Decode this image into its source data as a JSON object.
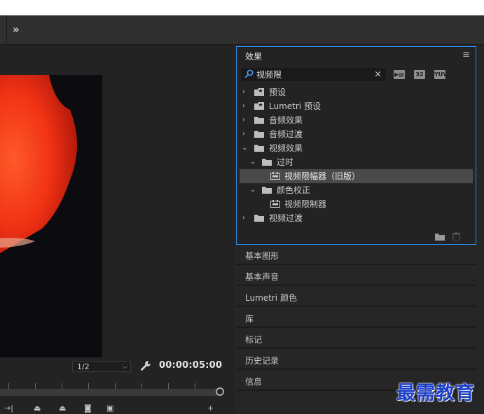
{
  "toolbar": {
    "more_label": "»"
  },
  "monitor": {
    "zoom_value": "1/2",
    "timecode": "00:00:05:00"
  },
  "effects_panel": {
    "title": "效果",
    "menu_icon": "≡",
    "search": {
      "value": "视频限",
      "clear_icon": "×"
    },
    "filter_buttons": [
      {
        "name": "accelerated-effects-icon",
        "label": ""
      },
      {
        "name": "32bit-color-icon",
        "label": "32"
      },
      {
        "name": "yuv-effects-icon",
        "label": "YUV"
      }
    ],
    "tree": [
      {
        "label": "预设",
        "indent": 0,
        "expanded": false,
        "type": "preset-folder"
      },
      {
        "label": "Lumetri 预设",
        "indent": 0,
        "expanded": false,
        "type": "preset-folder"
      },
      {
        "label": "音频效果",
        "indent": 0,
        "expanded": false,
        "type": "folder"
      },
      {
        "label": "音频过渡",
        "indent": 0,
        "expanded": false,
        "type": "folder"
      },
      {
        "label": "视频效果",
        "indent": 0,
        "expanded": true,
        "type": "folder"
      },
      {
        "label": "过时",
        "indent": 1,
        "expanded": true,
        "type": "folder"
      },
      {
        "label": "视频限幅器（旧版）",
        "indent": 2,
        "type": "effect",
        "selected": true
      },
      {
        "label": "颜色校正",
        "indent": 1,
        "expanded": true,
        "type": "folder"
      },
      {
        "label": "视频限制器",
        "indent": 2,
        "type": "effect"
      },
      {
        "label": "视频过渡",
        "indent": 0,
        "expanded": false,
        "type": "folder"
      }
    ]
  },
  "panels": [
    {
      "label": "基本图形"
    },
    {
      "label": "基本声音"
    },
    {
      "label": "Lumetri 颜色"
    },
    {
      "label": "库"
    },
    {
      "label": "标记"
    },
    {
      "label": "历史记录"
    },
    {
      "label": "信息"
    }
  ],
  "watermark": "最需教育",
  "colors": {
    "accent": "#2d8ceb",
    "selection": "#4a4a4a",
    "panel_bg": "#232323",
    "watermark": "#1e3fc8"
  }
}
